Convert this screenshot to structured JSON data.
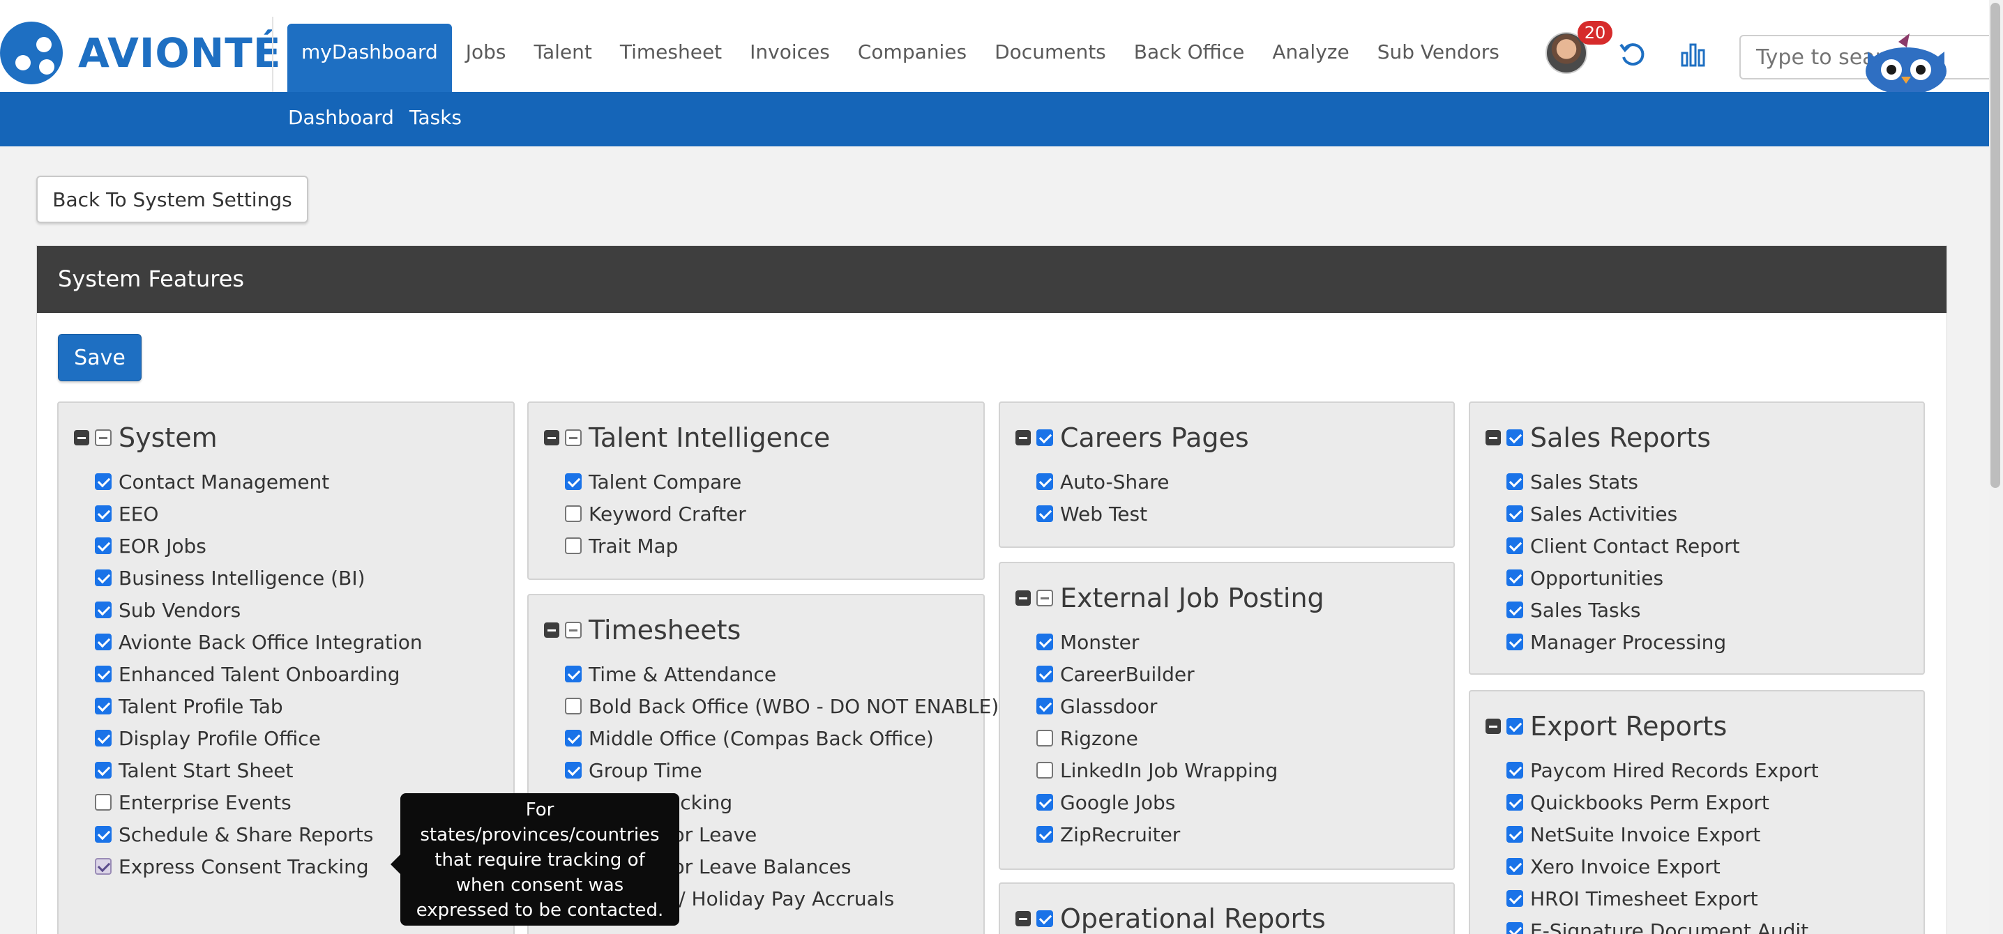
{
  "brand": {
    "name": "AVIONTÉ"
  },
  "nav": {
    "items": [
      "myDashboard",
      "Jobs",
      "Talent",
      "Timesheet",
      "Invoices",
      "Companies",
      "Documents",
      "Back Office",
      "Analyze",
      "Sub Vendors"
    ],
    "active": "myDashboard"
  },
  "header": {
    "notification_count": "20",
    "search_placeholder": "Type to search"
  },
  "subnav": {
    "items": [
      "Dashboard",
      "Tasks"
    ]
  },
  "page": {
    "back_label": "Back To System Settings",
    "panel_title": "System Features",
    "save_label": "Save"
  },
  "groups": [
    {
      "title": "System",
      "state": "indeterminate",
      "items": [
        {
          "label": "Contact Management",
          "checked": true
        },
        {
          "label": "EEO",
          "checked": true
        },
        {
          "label": "EOR Jobs",
          "checked": true
        },
        {
          "label": "Business Intelligence (BI)",
          "checked": true
        },
        {
          "label": "Sub Vendors",
          "checked": true
        },
        {
          "label": "Avionte Back Office Integration",
          "checked": true
        },
        {
          "label": "Enhanced Talent Onboarding",
          "checked": true
        },
        {
          "label": "Talent Profile Tab",
          "checked": true
        },
        {
          "label": "Display Profile Office",
          "checked": true
        },
        {
          "label": "Talent Start Sheet",
          "checked": true
        },
        {
          "label": "Enterprise Events",
          "checked": false
        },
        {
          "label": "Schedule & Share Reports",
          "checked": true
        },
        {
          "label": "Express Consent Tracking",
          "checked": true,
          "hover": true
        }
      ]
    },
    {
      "title": "Talent Intelligence",
      "state": "indeterminate",
      "items": [
        {
          "label": "Talent Compare",
          "checked": true
        },
        {
          "label": "Keyword Crafter",
          "checked": false
        },
        {
          "label": "Trait Map",
          "checked": false
        }
      ]
    },
    {
      "title": "Timesheets",
      "state": "indeterminate",
      "items": [
        {
          "label": "Time & Attendance",
          "checked": true
        },
        {
          "label": "Bold Back Office (WBO - DO NOT ENABLE)",
          "checked": false
        },
        {
          "label": "Middle Office (Compas Back Office)",
          "checked": true
        },
        {
          "label": "Group Time",
          "checked": true
        },
        {
          "label": "Break Tracking",
          "checked": true
        },
        {
          "label": "Contractor Leave",
          "checked": true
        },
        {
          "label": "Contractor Leave Balances",
          "checked": true
        },
        {
          "label": "Vacation / Holiday Pay Accruals",
          "checked": true
        }
      ]
    },
    {
      "title": "Careers Pages",
      "state": "checked",
      "items": [
        {
          "label": "Auto-Share",
          "checked": true
        },
        {
          "label": "Web Test",
          "checked": true
        }
      ]
    },
    {
      "title": "External Job Posting",
      "state": "indeterminate",
      "items": [
        {
          "label": "Monster",
          "checked": true
        },
        {
          "label": "CareerBuilder",
          "checked": true
        },
        {
          "label": "Glassdoor",
          "checked": true
        },
        {
          "label": "Rigzone",
          "checked": false
        },
        {
          "label": "LinkedIn Job Wrapping",
          "checked": false
        },
        {
          "label": "Google Jobs",
          "checked": true
        },
        {
          "label": "ZipRecruiter",
          "checked": true
        }
      ]
    },
    {
      "title": "Operational Reports",
      "state": "checked",
      "items": []
    },
    {
      "title": "Sales Reports",
      "state": "checked",
      "items": [
        {
          "label": "Sales Stats",
          "checked": true
        },
        {
          "label": "Sales Activities",
          "checked": true
        },
        {
          "label": "Client Contact Report",
          "checked": true
        },
        {
          "label": "Opportunities",
          "checked": true
        },
        {
          "label": "Sales Tasks",
          "checked": true
        },
        {
          "label": "Manager Processing",
          "checked": true
        }
      ]
    },
    {
      "title": "Export Reports",
      "state": "checked",
      "items": [
        {
          "label": "Paycom Hired Records Export",
          "checked": true
        },
        {
          "label": "Quickbooks Perm Export",
          "checked": true
        },
        {
          "label": "NetSuite Invoice Export",
          "checked": true
        },
        {
          "label": "Xero Invoice Export",
          "checked": true
        },
        {
          "label": "HROI Timesheet Export",
          "checked": true
        },
        {
          "label": "E-Signature Document Audit",
          "checked": true
        }
      ]
    }
  ],
  "tooltip": {
    "text": "For states/provinces/countries that require tracking of when consent was expressed to be contacted."
  },
  "icons": {
    "refresh": "refresh-icon",
    "analytics": "bar-chart-icon",
    "mascot": "owl-mascot-icon"
  },
  "colors": {
    "brand": "#1e6fc2",
    "subnav": "#1565b8",
    "panel_header": "#3e3e3e",
    "checkbox": "#1a73e8",
    "badge": "#d62b2b"
  }
}
